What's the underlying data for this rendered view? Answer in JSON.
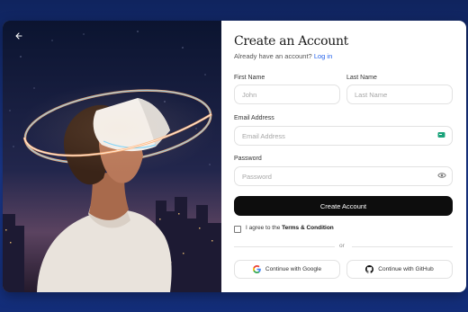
{
  "form": {
    "title": "Create an Account",
    "subtitle_prefix": "Already have an account?",
    "login_link": "Log in",
    "first_name_label": "First Name",
    "first_name_placeholder": "John",
    "last_name_label": "Last Name",
    "last_name_placeholder": "Last Name",
    "email_label": "Email Address",
    "email_placeholder": "Email Address",
    "password_label": "Password",
    "password_placeholder": "Password",
    "submit_label": "Create Account",
    "terms_prefix": "I agree to the",
    "terms_link": "Terms & Condition",
    "divider_text": "or",
    "google_label": "Continue with Google",
    "github_label": "Continue with GitHub"
  },
  "colors": {
    "page_background": "#1b3a93",
    "primary_button": "#0d0d0d",
    "link": "#2563eb",
    "email_icon": "#1aa37a"
  },
  "icons": {
    "back": "arrow-left-icon",
    "email_field": "email-badge-icon",
    "password_toggle": "eye-icon",
    "google": "google-icon",
    "github": "github-icon"
  }
}
